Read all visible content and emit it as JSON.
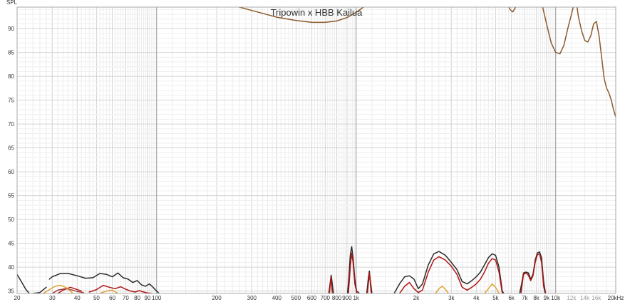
{
  "chart_data": {
    "type": "line",
    "title": "Tripowin x HBB Kailua",
    "ylabel": "SPL",
    "xlabel": "",
    "x_scale": "log",
    "xlim": [
      20,
      20000
    ],
    "ylim": [
      34.5,
      94.5
    ],
    "grid": true,
    "yticks": [
      35,
      40,
      45,
      50,
      55,
      60,
      65,
      70,
      75,
      80,
      85,
      90
    ],
    "xticks": [
      {
        "v": 20,
        "label": "20"
      },
      {
        "v": 30,
        "label": "30"
      },
      {
        "v": 40,
        "label": "40"
      },
      {
        "v": 50,
        "label": "50"
      },
      {
        "v": 60,
        "label": "60"
      },
      {
        "v": 70,
        "label": "70"
      },
      {
        "v": 80,
        "label": "80"
      },
      {
        "v": 90,
        "label": "90"
      },
      {
        "v": 100,
        "label": "100"
      },
      {
        "v": 200,
        "label": "200"
      },
      {
        "v": 300,
        "label": "300"
      },
      {
        "v": 400,
        "label": "400"
      },
      {
        "v": 500,
        "label": "500"
      },
      {
        "v": 600,
        "label": "600"
      },
      {
        "v": 700,
        "label": "700"
      },
      {
        "v": 800,
        "label": "800"
      },
      {
        "v": 900,
        "label": "900"
      },
      {
        "v": 1000,
        "label": "1k"
      },
      {
        "v": 2000,
        "label": "2k"
      },
      {
        "v": 3000,
        "label": "3k"
      },
      {
        "v": 4000,
        "label": "4k"
      },
      {
        "v": 5000,
        "label": "5k"
      },
      {
        "v": 6000,
        "label": "6k"
      },
      {
        "v": 7000,
        "label": "7k"
      },
      {
        "v": 8000,
        "label": "8k"
      },
      {
        "v": 9000,
        "label": "9k"
      },
      {
        "v": 10000,
        "label": "10k"
      },
      {
        "v": 12000,
        "label": "12k",
        "minor": true
      },
      {
        "v": 14000,
        "label": "14k",
        "minor": true
      },
      {
        "v": 16000,
        "label": "16k",
        "minor": true
      },
      {
        "v": 20000,
        "label": "20kHz"
      }
    ],
    "series": [
      {
        "color": "#8b5a2b",
        "segments": [
          [
            [
              200,
              95.5
            ],
            [
              250,
              94.7
            ],
            [
              300,
              93.8
            ],
            [
              400,
              92.4
            ],
            [
              500,
              91.7
            ],
            [
              600,
              91.3
            ],
            [
              700,
              91.3
            ],
            [
              800,
              91.6
            ],
            [
              900,
              92.3
            ],
            [
              1000,
              93.4
            ],
            [
              1150,
              95.2
            ]
          ],
          [
            [
              5700,
              95.5
            ],
            [
              5900,
              94.0
            ],
            [
              6100,
              93.5
            ],
            [
              6300,
              94.5
            ],
            [
              6450,
              95.5
            ]
          ],
          [
            [
              8500,
              95.5
            ],
            [
              9000,
              91.0
            ],
            [
              9500,
              87.0
            ],
            [
              10000,
              85.0
            ],
            [
              10500,
              84.7
            ],
            [
              11000,
              86.5
            ],
            [
              11500,
              90.0
            ],
            [
              12000,
              93.0
            ],
            [
              12300,
              94.8
            ],
            [
              12500,
              95.5
            ]
          ],
          [
            [
              12700,
              95.5
            ],
            [
              13000,
              92.5
            ],
            [
              13500,
              89.5
            ],
            [
              14000,
              87.5
            ],
            [
              14500,
              87.2
            ],
            [
              15000,
              88.5
            ],
            [
              15500,
              91.0
            ],
            [
              16000,
              91.5
            ],
            [
              16500,
              88.5
            ],
            [
              17000,
              84.0
            ],
            [
              17500,
              79.5
            ],
            [
              18000,
              77.5
            ],
            [
              18500,
              76.5
            ],
            [
              19000,
              75.0
            ],
            [
              19500,
              73.0
            ],
            [
              20000,
              71.5
            ]
          ]
        ]
      },
      {
        "color": "#2b2b2b",
        "segments": [
          [
            [
              20,
              38.5
            ],
            [
              21,
              37.0
            ],
            [
              22,
              35.5
            ],
            [
              23,
              34.5
            ]
          ],
          [
            [
              24,
              34.5
            ],
            [
              26,
              34.7
            ],
            [
              28,
              35.8
            ]
          ],
          [
            [
              29,
              37.5
            ],
            [
              30,
              38.0
            ],
            [
              33,
              38.7
            ],
            [
              36,
              38.7
            ],
            [
              40,
              38.2
            ],
            [
              44,
              37.7
            ],
            [
              48,
              37.8
            ],
            [
              52,
              38.7
            ],
            [
              56,
              38.5
            ],
            [
              60,
              38.0
            ],
            [
              64,
              38.8
            ],
            [
              68,
              37.8
            ],
            [
              72,
              37.5
            ],
            [
              76,
              36.8
            ],
            [
              80,
              37.2
            ],
            [
              84,
              36.3
            ],
            [
              88,
              36.0
            ],
            [
              92,
              36.5
            ],
            [
              96,
              35.8
            ],
            [
              100,
              35.0
            ],
            [
              103,
              34.5
            ]
          ],
          [
            [
              730,
              34.5
            ],
            [
              740,
              36.5
            ],
            [
              750,
              38.3
            ],
            [
              760,
              36.5
            ],
            [
              770,
              34.5
            ]
          ],
          [
            [
              905,
              34.5
            ],
            [
              920,
              38.0
            ],
            [
              935,
              42.5
            ],
            [
              950,
              44.3
            ],
            [
              965,
              42.0
            ],
            [
              985,
              37.5
            ],
            [
              1005,
              35.0
            ],
            [
              1040,
              34.5
            ]
          ],
          [
            [
              1130,
              34.5
            ],
            [
              1150,
              37.5
            ],
            [
              1165,
              39.2
            ],
            [
              1180,
              37.0
            ],
            [
              1200,
              34.5
            ]
          ],
          [
            [
              1550,
              34.5
            ],
            [
              1650,
              36.5
            ],
            [
              1750,
              38.0
            ],
            [
              1850,
              38.2
            ],
            [
              1950,
              37.5
            ],
            [
              2050,
              35.5
            ],
            [
              2150,
              36.5
            ],
            [
              2300,
              40.5
            ],
            [
              2450,
              42.8
            ],
            [
              2600,
              43.3
            ],
            [
              2800,
              42.5
            ],
            [
              3000,
              41.0
            ],
            [
              3200,
              39.5
            ],
            [
              3400,
              37.0
            ],
            [
              3600,
              36.5
            ],
            [
              3800,
              37.2
            ],
            [
              4000,
              38.0
            ],
            [
              4200,
              39.0
            ],
            [
              4400,
              40.5
            ],
            [
              4600,
              42.0
            ],
            [
              4800,
              42.8
            ],
            [
              5000,
              42.5
            ],
            [
              5200,
              40.0
            ],
            [
              5400,
              35.0
            ],
            [
              5500,
              34.5
            ]
          ],
          [
            [
              6600,
              34.5
            ],
            [
              6750,
              36.5
            ],
            [
              6900,
              38.8
            ],
            [
              7100,
              39.0
            ],
            [
              7300,
              38.8
            ],
            [
              7500,
              37.5
            ],
            [
              7700,
              38.5
            ],
            [
              7900,
              41.5
            ],
            [
              8100,
              43.0
            ],
            [
              8300,
              43.2
            ],
            [
              8500,
              42.0
            ],
            [
              8700,
              37.0
            ],
            [
              8900,
              34.5
            ]
          ]
        ]
      },
      {
        "color": "#b01515",
        "segments": [
          [
            [
              32,
              34.5
            ],
            [
              34,
              35.2
            ],
            [
              37,
              35.8
            ],
            [
              40,
              35.3
            ],
            [
              42,
              35.0
            ]
          ],
          [
            [
              46,
              34.8
            ],
            [
              50,
              35.3
            ],
            [
              54,
              36.2
            ],
            [
              58,
              35.8
            ],
            [
              62,
              35.5
            ],
            [
              66,
              35.9
            ],
            [
              70,
              35.4
            ],
            [
              74,
              35.0
            ],
            [
              78,
              34.8
            ],
            [
              82,
              35.1
            ],
            [
              86,
              34.8
            ],
            [
              90,
              34.6
            ],
            [
              95,
              34.5
            ]
          ],
          [
            [
              735,
              34.5
            ],
            [
              748,
              38.0
            ],
            [
              760,
              34.5
            ]
          ],
          [
            [
              915,
              34.5
            ],
            [
              935,
              40.0
            ],
            [
              950,
              43.0
            ],
            [
              965,
              41.0
            ],
            [
              985,
              36.5
            ],
            [
              1010,
              34.5
            ]
          ],
          [
            [
              1140,
              34.5
            ],
            [
              1165,
              38.8
            ],
            [
              1190,
              34.5
            ]
          ],
          [
            [
              1650,
              34.5
            ],
            [
              1750,
              36.0
            ],
            [
              1850,
              36.8
            ],
            [
              1950,
              35.5
            ],
            [
              2050,
              34.7
            ],
            [
              2150,
              35.2
            ],
            [
              2300,
              39.0
            ],
            [
              2450,
              41.5
            ],
            [
              2600,
              42.2
            ],
            [
              2800,
              41.5
            ],
            [
              3000,
              40.2
            ],
            [
              3200,
              38.5
            ],
            [
              3400,
              35.8
            ],
            [
              3600,
              35.2
            ],
            [
              3800,
              35.8
            ],
            [
              4000,
              36.5
            ],
            [
              4200,
              37.5
            ],
            [
              4400,
              39.0
            ],
            [
              4600,
              40.8
            ],
            [
              4800,
              41.8
            ],
            [
              5000,
              41.5
            ],
            [
              5200,
              39.0
            ],
            [
              5400,
              34.5
            ]
          ],
          [
            [
              6700,
              34.5
            ],
            [
              6900,
              38.5
            ],
            [
              7100,
              38.8
            ],
            [
              7300,
              38.3
            ],
            [
              7500,
              37.2
            ],
            [
              7700,
              38.2
            ],
            [
              7900,
              41.0
            ],
            [
              8100,
              42.6
            ],
            [
              8300,
              42.8
            ],
            [
              8500,
              41.0
            ],
            [
              8700,
              36.0
            ],
            [
              8850,
              34.5
            ]
          ]
        ]
      },
      {
        "color": "#a04040",
        "segments": [
          [
            [
              30,
              34.5
            ],
            [
              32,
              35.2
            ],
            [
              35,
              35.5
            ],
            [
              38,
              35.2
            ],
            [
              40,
              34.9
            ],
            [
              43,
              34.7
            ]
          ]
        ]
      },
      {
        "color": "#e0a030",
        "segments": [
          [
            [
              27,
              34.5
            ],
            [
              29,
              35.3
            ],
            [
              31,
              36.0
            ],
            [
              33,
              36.2
            ],
            [
              35,
              35.8
            ],
            [
              37,
              35.0
            ],
            [
              38,
              34.5
            ]
          ],
          [
            [
              52,
              34.5
            ],
            [
              56,
              35.0
            ],
            [
              60,
              35.2
            ],
            [
              64,
              34.5
            ]
          ],
          [
            [
              2500,
              34.5
            ],
            [
              2600,
              35.5
            ],
            [
              2700,
              36.0
            ],
            [
              2800,
              35.4
            ],
            [
              2900,
              34.5
            ]
          ],
          [
            [
              4400,
              34.5
            ],
            [
              4600,
              35.5
            ],
            [
              4800,
              36.5
            ],
            [
              5000,
              35.8
            ],
            [
              5200,
              34.5
            ]
          ]
        ]
      }
    ]
  }
}
